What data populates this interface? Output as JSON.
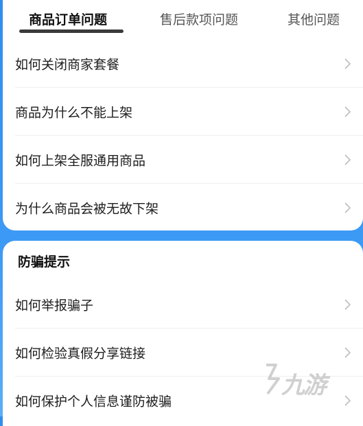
{
  "tabs": [
    {
      "label": "商品订单问题",
      "active": true
    },
    {
      "label": "售后款项问题",
      "active": false
    },
    {
      "label": "其他问题",
      "active": false
    }
  ],
  "order_questions": [
    {
      "label": "如何关闭商家套餐"
    },
    {
      "label": "商品为什么不能上架"
    },
    {
      "label": "如何上架全服通用商品"
    },
    {
      "label": "为什么商品会被无故下架"
    }
  ],
  "fraud_section": {
    "title": "防骗提示",
    "items": [
      {
        "label": "如何举报骗子"
      },
      {
        "label": "如何检验真假分享链接"
      },
      {
        "label": "如何保护个人信息谨防被骗"
      }
    ]
  },
  "watermark": {
    "text": "九游"
  },
  "colors": {
    "background": "#2f8ef0",
    "card": "#ffffff",
    "chevron": "#bdbdbd"
  }
}
